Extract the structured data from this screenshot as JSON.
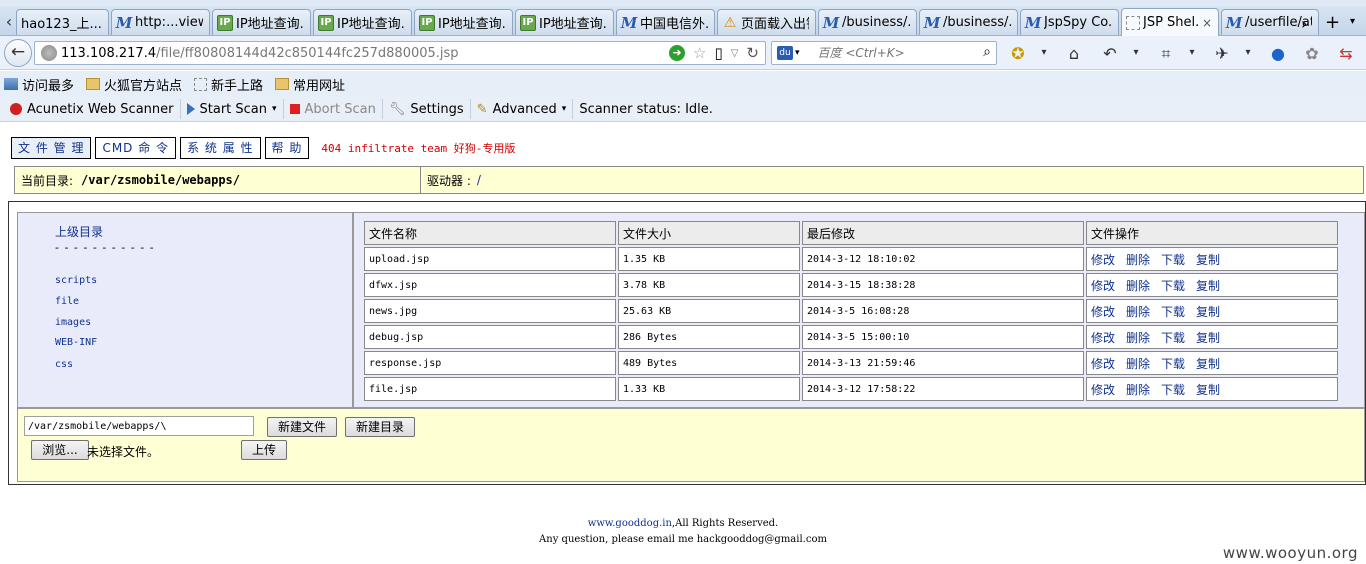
{
  "browser": {
    "tabs": [
      {
        "label": "hao123_上...",
        "icon": "none"
      },
      {
        "label": "http:...view&",
        "icon": "m"
      },
      {
        "label": "IP地址查询...",
        "icon": "ip"
      },
      {
        "label": "IP地址查询...",
        "icon": "ip"
      },
      {
        "label": "IP地址查询...",
        "icon": "ip"
      },
      {
        "label": "IP地址查询...",
        "icon": "ip"
      },
      {
        "label": "中国电信外...",
        "icon": "m"
      },
      {
        "label": "页面载入出错",
        "icon": "warn"
      },
      {
        "label": "/business/...",
        "icon": "m"
      },
      {
        "label": "/business/...",
        "icon": "m"
      },
      {
        "label": "JspSpy Co...",
        "icon": "m"
      },
      {
        "label": "JSP Shel...",
        "icon": "blank",
        "active": true
      },
      {
        "label": "/userfile/at...",
        "icon": "m"
      }
    ],
    "url_host": "113.108.217.4",
    "url_path": "/file/ff80808144d42c850144fc257d880005.jsp",
    "search_placeholder": "百度 <Ctrl+K>",
    "bookmarks": [
      "访问最多",
      "火狐官方站点",
      "新手上路",
      "常用网址"
    ],
    "acunetix": {
      "name": "Acunetix Web Scanner",
      "start": "Start Scan",
      "abort": "Abort Scan",
      "settings": "Settings",
      "advanced": "Advanced",
      "status": "Scanner status: Idle."
    }
  },
  "shell": {
    "menu": [
      "文 件 管 理",
      "CMD 命 令",
      "系 统 属 性",
      "帮 助"
    ],
    "team_label": "404 infiltrate team 好狗-专用版",
    "current_dir_label": "当前目录:",
    "current_dir": "/var/zsmobile/webapps/",
    "drive_label": "驱动器 :",
    "drive_value": "/",
    "up_dir": "上级目录",
    "dashes": "- - - - - - - - - - -",
    "dirs": [
      "scripts",
      "file",
      "images",
      "WEB-INF",
      "css"
    ],
    "columns": [
      "文件名称",
      "文件大小",
      "最后修改",
      "文件操作"
    ],
    "ops": [
      "修改",
      "删除",
      "下载",
      "复制"
    ],
    "files": [
      {
        "name": "upload.jsp",
        "size": "1.35 KB",
        "modified": "2014-3-12 18:10:02"
      },
      {
        "name": "dfwx.jsp",
        "size": "3.78 KB",
        "modified": "2014-3-15 18:38:28"
      },
      {
        "name": "news.jpg",
        "size": "25.63 KB",
        "modified": "2014-3-5 16:08:28"
      },
      {
        "name": "debug.jsp",
        "size": "286 Bytes",
        "modified": "2014-3-5 15:00:10"
      },
      {
        "name": "response.jsp",
        "size": "489 Bytes",
        "modified": "2014-3-13 21:59:46"
      },
      {
        "name": "file.jsp",
        "size": "1.33 KB",
        "modified": "2014-3-12 17:58:22"
      }
    ],
    "path_value": "/var/zsmobile/webapps/\\",
    "new_file": "新建文件",
    "new_dir": "新建目录",
    "browse": "浏览...",
    "no_file": "未选择文件。",
    "upload": "上传"
  },
  "footer": {
    "site": "www.gooddog.in",
    "rights": ",All Rights Reserved.",
    "contact": "Any question, please email me hackgooddog@gmail.com"
  },
  "watermark": "www.wooyun.org"
}
